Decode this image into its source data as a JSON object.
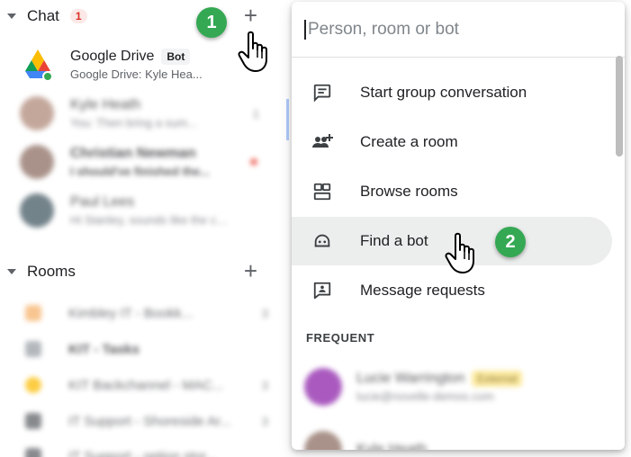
{
  "sidebar": {
    "chat_section": {
      "title": "Chat",
      "unread_count": "1"
    },
    "rooms_section": {
      "title": "Rooms"
    },
    "chats": [
      {
        "name": "Google Drive",
        "tag": "Bot",
        "preview": "Google Drive: Kyle Hea..."
      },
      {
        "name": "Kyle Heath",
        "preview": "You: Then bring a sum...",
        "count": "1"
      },
      {
        "name": "Christian Newman",
        "preview": "I should've finished the..."
      },
      {
        "name": "Paul Lees",
        "preview": "Hi Stanley, sounds like the ca..."
      }
    ],
    "rooms": [
      {
        "name": "Kimbley IT - Bookk...",
        "count": "3",
        "color": "#f6b26b"
      },
      {
        "name": "KIT - Tasks",
        "count": "",
        "color": "#9aa0a6"
      },
      {
        "name": "KIT Backchannel - MAC...",
        "count": "3",
        "color": "#fbbc04"
      },
      {
        "name": "IT Support - Shoreside Ar...",
        "count": "3",
        "color": "#5f6368"
      },
      {
        "name": "IT Support - option stor...",
        "count": "",
        "color": "#5f6368"
      }
    ]
  },
  "steps": {
    "one": "1",
    "two": "2"
  },
  "panel": {
    "search_placeholder": "Person, room or bot",
    "menu": [
      {
        "label": "Start group conversation",
        "icon": "group-conversation-icon"
      },
      {
        "label": "Create a room",
        "icon": "create-room-icon"
      },
      {
        "label": "Browse rooms",
        "icon": "browse-rooms-icon"
      },
      {
        "label": "Find a bot",
        "icon": "bot-icon"
      },
      {
        "label": "Message requests",
        "icon": "message-requests-icon"
      }
    ],
    "frequent_label": "FREQUENT",
    "frequent": [
      {
        "name": "Lucie Warrington",
        "tag": "External",
        "sub": "lucie@novelle-demos.com"
      },
      {
        "name": "Kyle Heath"
      }
    ]
  },
  "colors": {
    "accent_green": "#34a853",
    "badge_red": "#d93025",
    "hover_gray": "#eceded"
  }
}
